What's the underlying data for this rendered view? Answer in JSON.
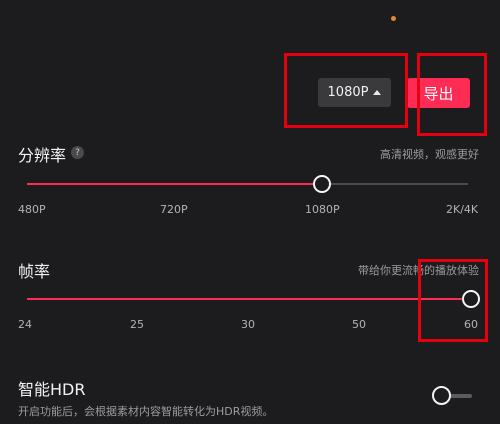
{
  "header": {
    "resolution_select_value": "1080P",
    "export_label": "导出"
  },
  "resolution": {
    "title": "分辨率",
    "help_glyph": "?",
    "hint": "高清视频，观感更好",
    "ticks": [
      "480P",
      "720P",
      "1080P",
      "2K/4K"
    ],
    "selected": "1080P"
  },
  "framerate": {
    "title": "帧率",
    "hint": "带给你更流畅的播放体验",
    "ticks": [
      "24",
      "25",
      "30",
      "50",
      "60"
    ],
    "selected": "60"
  },
  "hdr": {
    "title": "智能HDR",
    "description": "开启功能后，会根据素材内容智能转化为HDR视频。",
    "enabled": false
  },
  "colors": {
    "accent": "#fe2c55",
    "highlight_box": "#e3000f"
  }
}
